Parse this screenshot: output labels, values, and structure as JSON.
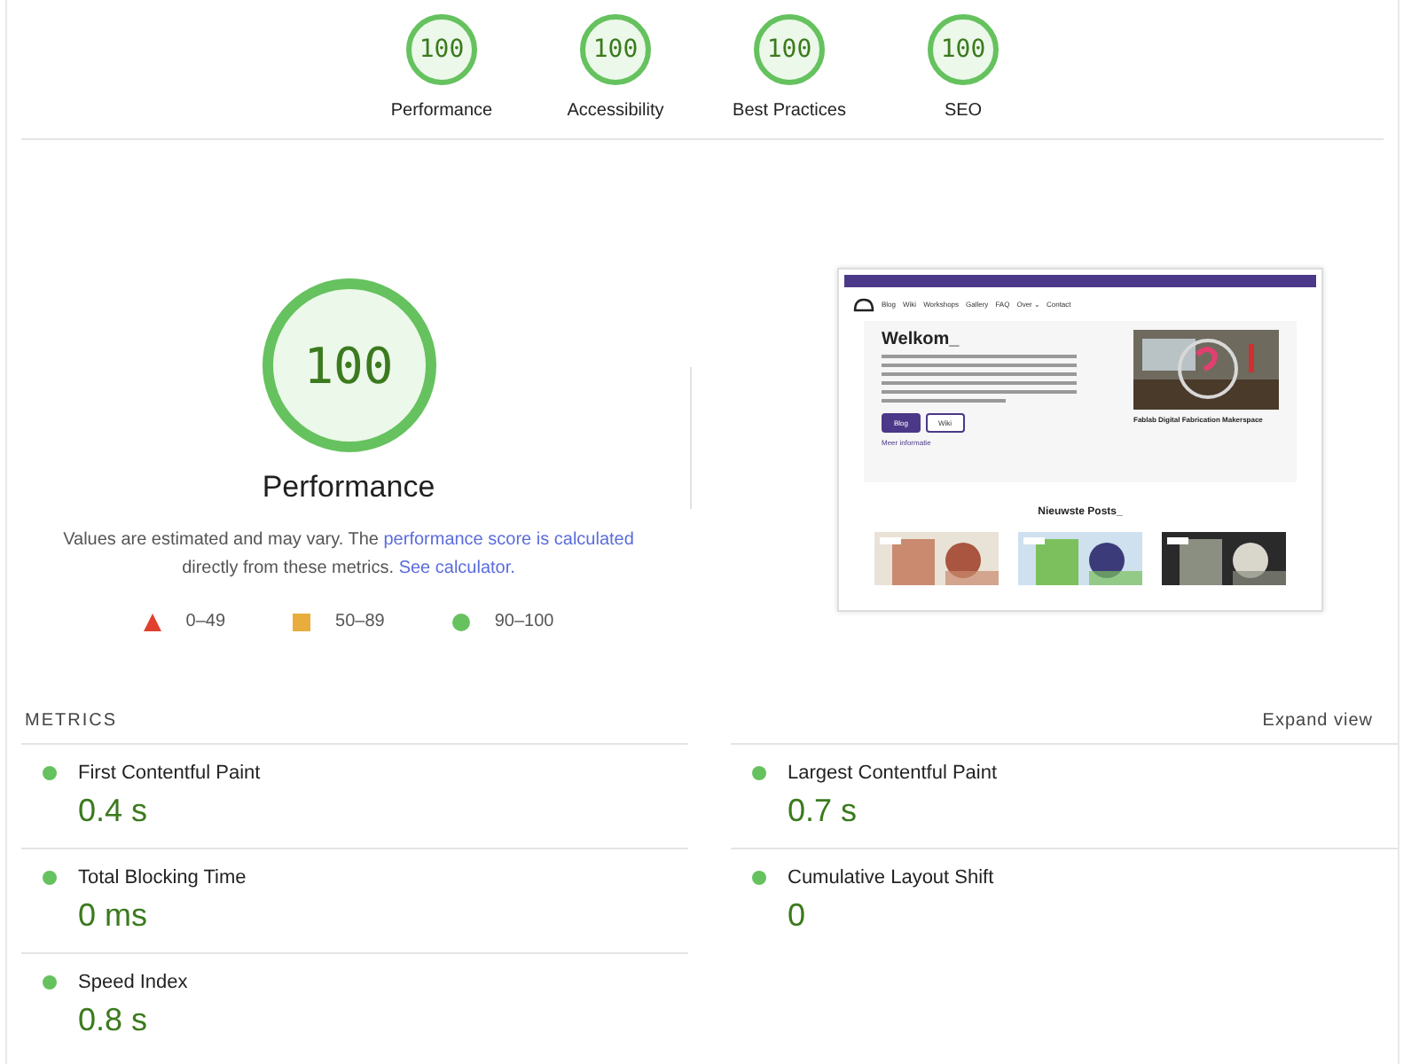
{
  "gauges": [
    {
      "score": "100",
      "label": "Performance",
      "level": 1
    },
    {
      "score": "100",
      "label": "Accessibility",
      "level": 1
    },
    {
      "score": "100",
      "label": "Best Practices",
      "level": 1
    },
    {
      "score": "100",
      "label": "SEO",
      "level": 1
    }
  ],
  "performance": {
    "score": "100",
    "level": 1,
    "title": "Performance",
    "note_before": "Values are estimated and may vary. The ",
    "note_link": "performance score is calculated",
    "note_middle": " directly from these metrics. ",
    "note_link2": "See calculator.",
    "legend": [
      {
        "kind": "triangle",
        "range": "0–49",
        "color": "#e0412e"
      },
      {
        "kind": "square",
        "range": "50–89",
        "color": "#e8ad3c"
      },
      {
        "kind": "circle",
        "range": "90–100",
        "color": "#65c25e"
      }
    ]
  },
  "screenshot": {
    "nav": [
      "Blog",
      "Wiki",
      "Workshops",
      "Gallery",
      "FAQ",
      "Over ⌄",
      "Contact"
    ],
    "heading": "Welkom_",
    "primary_button": "Blog",
    "secondary_button": "Wiki",
    "more_link": "Meer informatie",
    "card_title": "Fablab Digital Fabrication Makerspace",
    "posts_heading": "Nieuwste Posts_"
  },
  "metrics": {
    "title": "METRICS",
    "expand": "Expand view",
    "items": [
      {
        "name": "First Contentful Paint",
        "value": "0.4 s",
        "color": "#65c25e"
      },
      {
        "name": "Largest Contentful Paint",
        "value": "0.7 s",
        "color": "#65c25e"
      },
      {
        "name": "Total Blocking Time",
        "value": "0 ms",
        "color": "#65c25e"
      },
      {
        "name": "Cumulative Layout Shift",
        "value": "0",
        "color": "#65c25e"
      },
      {
        "name": "Speed Index",
        "value": "0.8 s",
        "color": "#65c25e"
      }
    ]
  }
}
